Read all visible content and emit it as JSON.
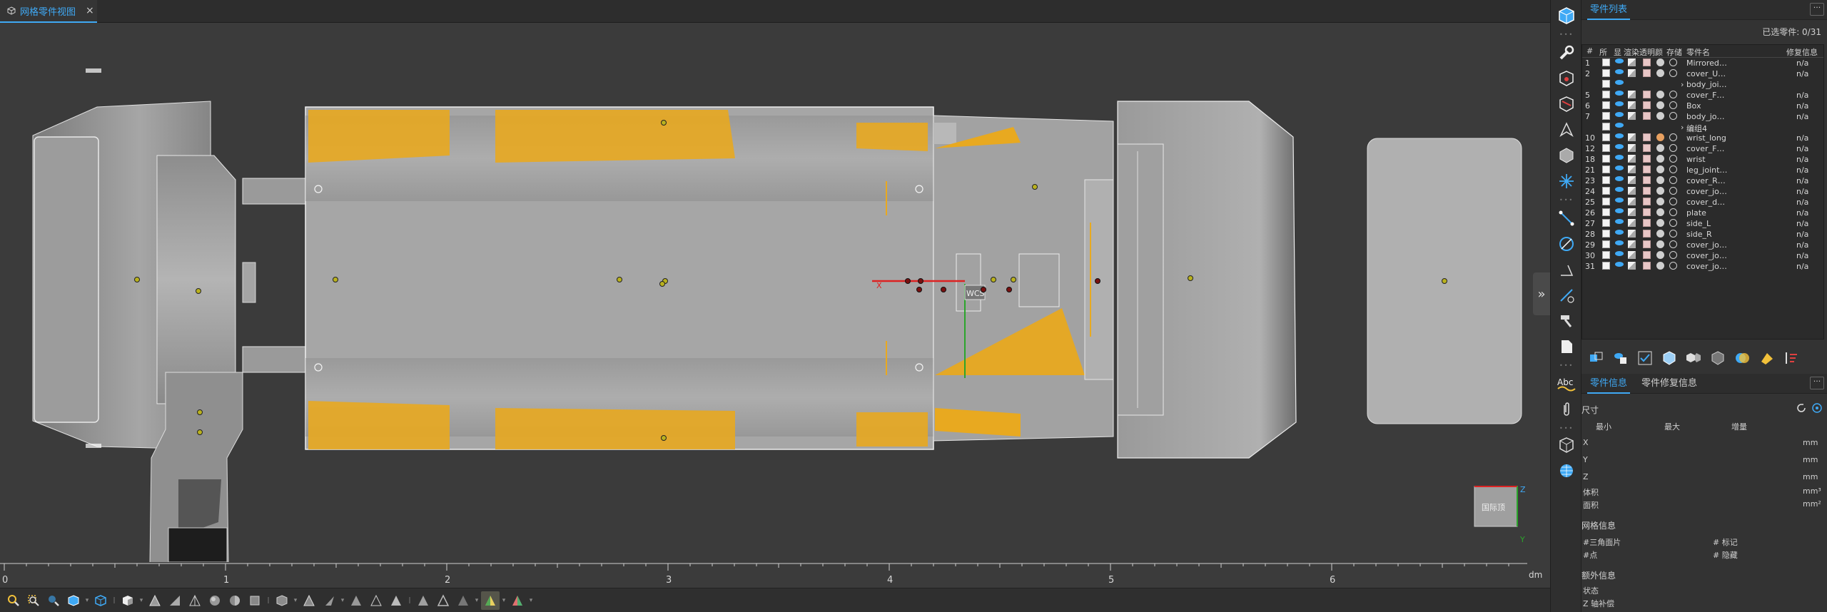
{
  "doc_tab": {
    "label": "网格零件视图",
    "close": "×"
  },
  "ruler": {
    "ticks": [
      "0",
      "1",
      "2",
      "3",
      "4",
      "5",
      "6"
    ],
    "unit": "dm"
  },
  "viewport": {
    "wcs_label": "WCS",
    "axis_x_label": "X",
    "viewcube": {
      "face_label": "国际顶",
      "axis_z": "Z",
      "axis_y": "Y"
    }
  },
  "panel": {
    "parts_tab": "零件列表",
    "more": "···",
    "selected_label": "已选零件: 0/31",
    "columns": [
      "#",
      "所",
      "显",
      "渲染",
      "透明",
      "颜",
      "存储",
      "零件名",
      "修复信息"
    ],
    "rows": [
      {
        "num": "1",
        "name": "Mirrored…",
        "repair": "n/a",
        "kind": "part"
      },
      {
        "num": "2",
        "name": "cover_U…",
        "repair": "n/a",
        "kind": "part"
      },
      {
        "num": "",
        "name": "body_joi…",
        "repair": "",
        "kind": "group"
      },
      {
        "num": "5",
        "name": "cover_F…",
        "repair": "n/a",
        "kind": "part"
      },
      {
        "num": "6",
        "name": "Box",
        "repair": "n/a",
        "kind": "part"
      },
      {
        "num": "7",
        "name": "body_jo…",
        "repair": "n/a",
        "kind": "part"
      },
      {
        "num": "",
        "name": "编组4",
        "repair": "",
        "kind": "group"
      },
      {
        "num": "10",
        "name": "wrist_long",
        "repair": "n/a",
        "kind": "part",
        "orange": true
      },
      {
        "num": "12",
        "name": "cover_F…",
        "repair": "n/a",
        "kind": "part"
      },
      {
        "num": "18",
        "name": "wrist",
        "repair": "n/a",
        "kind": "part"
      },
      {
        "num": "21",
        "name": "leg_joint…",
        "repair": "n/a",
        "kind": "part"
      },
      {
        "num": "23",
        "name": "cover_R…",
        "repair": "n/a",
        "kind": "part"
      },
      {
        "num": "24",
        "name": "cover_jo…",
        "repair": "n/a",
        "kind": "part"
      },
      {
        "num": "25",
        "name": "cover_d…",
        "repair": "n/a",
        "kind": "part"
      },
      {
        "num": "26",
        "name": "plate",
        "repair": "n/a",
        "kind": "part"
      },
      {
        "num": "27",
        "name": "side_L",
        "repair": "n/a",
        "kind": "part"
      },
      {
        "num": "28",
        "name": "side_R",
        "repair": "n/a",
        "kind": "part"
      },
      {
        "num": "29",
        "name": "cover_jo…",
        "repair": "n/a",
        "kind": "part"
      },
      {
        "num": "30",
        "name": "cover_jo…",
        "repair": "n/a",
        "kind": "part"
      },
      {
        "num": "31",
        "name": "cover_jo…",
        "repair": "n/a",
        "kind": "part"
      }
    ],
    "info_tabs": [
      "零件信息",
      "零件修复信息"
    ],
    "info": {
      "size_title": "尺寸",
      "col_min": "最小",
      "col_max": "最大",
      "col_delta": "增量",
      "x": "X",
      "y": "Y",
      "z": "Z",
      "unit_mm": "mm",
      "volume": "体积",
      "volume_unit": "mm³",
      "area": "面积",
      "area_unit": "mm²",
      "mesh_title": "网格信息",
      "triangles": "#三角面片",
      "points": "#点",
      "marked": "# 标记",
      "hidden": "# 隐藏",
      "extra_title": "额外信息",
      "status": "状态",
      "z_comp": "Z 轴补偿"
    }
  },
  "icons": {
    "strip": [
      "cube-view-icon",
      "wrench-icon",
      "box-measure-icon",
      "cut-plane-icon",
      "point-icon",
      "hexagon-icon",
      "star-burst-icon",
      "line-icon",
      "circle-icon",
      "angle-icon",
      "distance-icon",
      "hammer-icon",
      "document-icon",
      "abc-text-icon",
      "paperclip-icon",
      "wire-box-icon",
      "sphere-mesh-icon"
    ]
  },
  "colors": {
    "accent": "#3fa9f5",
    "highlight": "#e8a920",
    "mesh": "#a9a9a9",
    "background": "#3b3b3b"
  }
}
